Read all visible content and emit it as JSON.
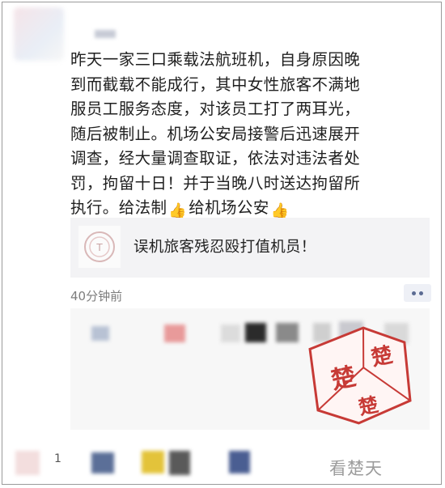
{
  "post": {
    "text": "昨天一家三口乘载法航班机，自身原因晚\n到而截载不能成行，其中女性旅客不满地\n服员工服务态度，对该员工打了两耳光，\n随后被制止。机场公安局接警后迅速展开\n调查，经大量调查取证，依法对违法者处\n罚，拘留十日！并于当晚八时送达拘留所\n执行。给法制",
    "text_mid": "给机场公安",
    "emoji": "thumbs-up-icon"
  },
  "share_card": {
    "title": "误机旅客残忍殴打值机员！"
  },
  "meta": {
    "time": "40分钟前"
  },
  "bottom": {
    "page_marker": "1"
  },
  "stamp": {
    "chars": [
      "楚",
      "楚"
    ],
    "color": "#c73a36"
  },
  "watermark": {
    "text": "看楚天"
  }
}
